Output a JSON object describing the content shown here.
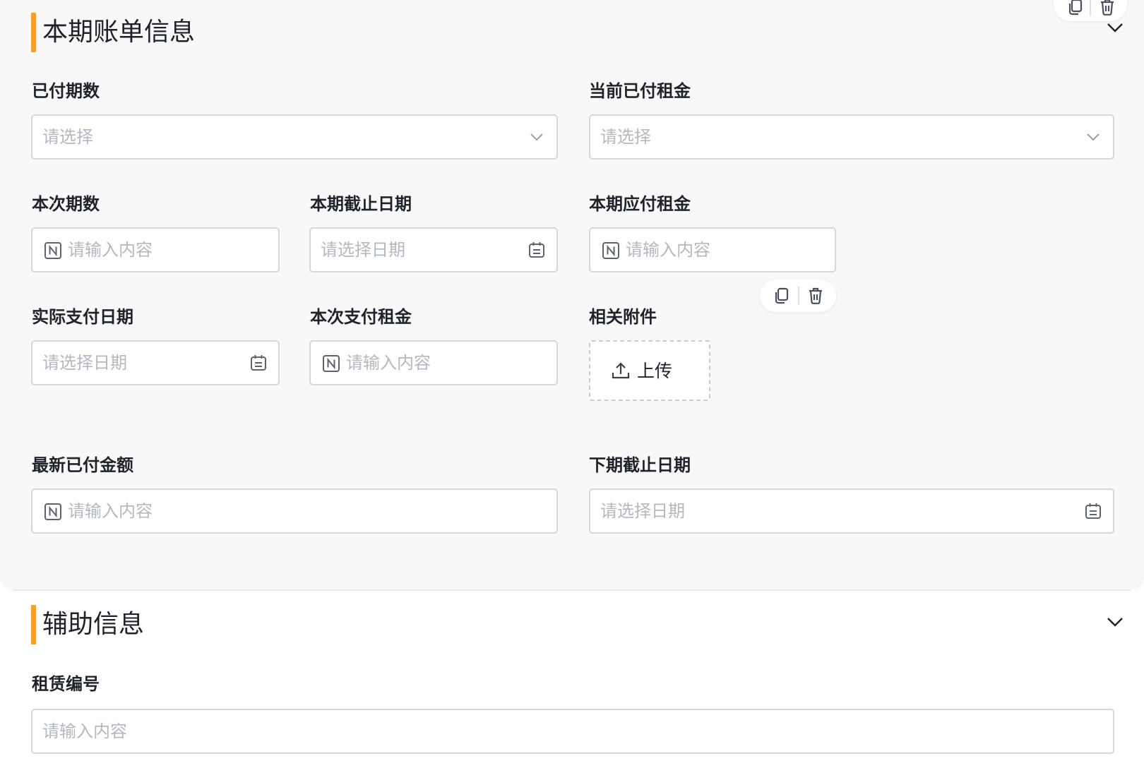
{
  "section_billing": {
    "title": "本期账单信息",
    "fields": {
      "paid_periods": {
        "label": "已付期数",
        "placeholder": "请选择"
      },
      "current_paid_rent": {
        "label": "当前已付租金",
        "placeholder": "请选择"
      },
      "this_period_number": {
        "label": "本次期数",
        "placeholder": "请输入内容"
      },
      "period_end_date": {
        "label": "本期截止日期",
        "placeholder": "请选择日期"
      },
      "period_payable_rent": {
        "label": "本期应付租金",
        "placeholder": "请输入内容"
      },
      "actual_pay_date": {
        "label": "实际支付日期",
        "placeholder": "请选择日期"
      },
      "this_pay_rent": {
        "label": "本次支付租金",
        "placeholder": "请输入内容"
      },
      "attachments": {
        "label": "相关附件",
        "upload_label": "上传"
      },
      "latest_paid_amount": {
        "label": "最新已付金额",
        "placeholder": "请输入内容"
      },
      "next_period_end_date": {
        "label": "下期截止日期",
        "placeholder": "请选择日期"
      }
    }
  },
  "section_aux": {
    "title": "辅助信息",
    "fields": {
      "lease_number": {
        "label": "租赁编号",
        "placeholder": "请输入内容"
      }
    }
  },
  "icons": {
    "select": "chevron-down-icon",
    "date": "calendar-icon",
    "number": "number-n-icon",
    "upload": "upload-icon",
    "copy": "copy-icon",
    "delete": "trash-icon",
    "collapse": "chevron-down-icon"
  },
  "colors": {
    "accent_bar": "#f0a030",
    "section_bg": "#f8f8f9",
    "border": "#d4d7dc",
    "placeholder": "#b4b8bf",
    "text": "#1f2329"
  }
}
